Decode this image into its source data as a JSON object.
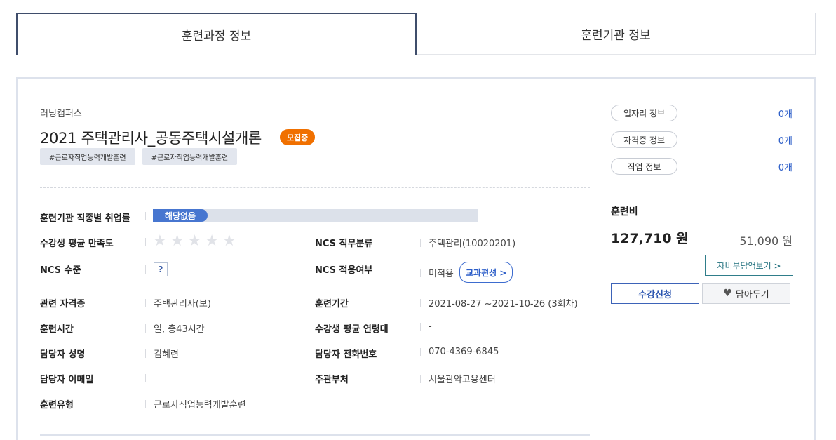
{
  "tabs": [
    {
      "label": "훈련과정 정보",
      "active": true
    },
    {
      "label": "훈련기관 정보",
      "active": false
    }
  ],
  "course": {
    "org": "러닝캠퍼스",
    "title": "2021 주택관리사_공동주택시설개론",
    "status_badge": "모집중",
    "tags": [
      "#근로자직업능력개발훈련",
      "#근로자직업능력개발훈련"
    ]
  },
  "details": {
    "employment_rate_label": "훈련기관 직종별 취업률",
    "employment_rate_value": "해당없음",
    "satisfaction_label": "수강생 평균 만족도",
    "satisfaction_stars": 0,
    "ncs_category_label": "NCS 직무분류",
    "ncs_category_value": "주택관리(10020201)",
    "ncs_level_label": "NCS 수준",
    "ncs_level_value": "?",
    "ncs_applied_label": "NCS 적용여부",
    "ncs_applied_value": "미적용",
    "curriculum_button": "교과편성 >",
    "license_label": "관련 자격증",
    "license_value": "주택관리사(보)",
    "period_label": "훈련기간",
    "period_value": "2021-08-27 ~2021-10-26 (3회차)",
    "hours_label": "훈련시간",
    "hours_value": "일, 총43시간",
    "age_label": "수강생 평균 연령대",
    "age_value": "-",
    "manager_name_label": "담당자 성명",
    "manager_name_value": "김혜련",
    "manager_phone_label": "담당자 전화번호",
    "manager_phone_value": "070-4369-6845",
    "manager_email_label": "담당자 이메일",
    "manager_email_value": "",
    "dept_label": "주관부처",
    "dept_value": "서울관악고용센터",
    "type_label": "훈련유형",
    "type_value": "근로자직업능력개발훈련"
  },
  "side": {
    "links": [
      {
        "label": "일자리 정보",
        "count": "0개"
      },
      {
        "label": "자격증 정보",
        "count": "0개"
      },
      {
        "label": "직업 정보",
        "count": "0개"
      }
    ],
    "fee_title": "훈련비",
    "fee_main": "127,710 원",
    "fee_sub": "51,090 원",
    "self_pay_button": "자비부담액보기 >",
    "apply_button": "수강신청",
    "wish_button": "담아두기"
  },
  "colors": {
    "accent": "#2b5dc8",
    "badge_orange": "#f07000",
    "tab_border": "#3f4d6b"
  },
  "icons": {
    "star": "star-icon",
    "heart": "heart-icon"
  }
}
